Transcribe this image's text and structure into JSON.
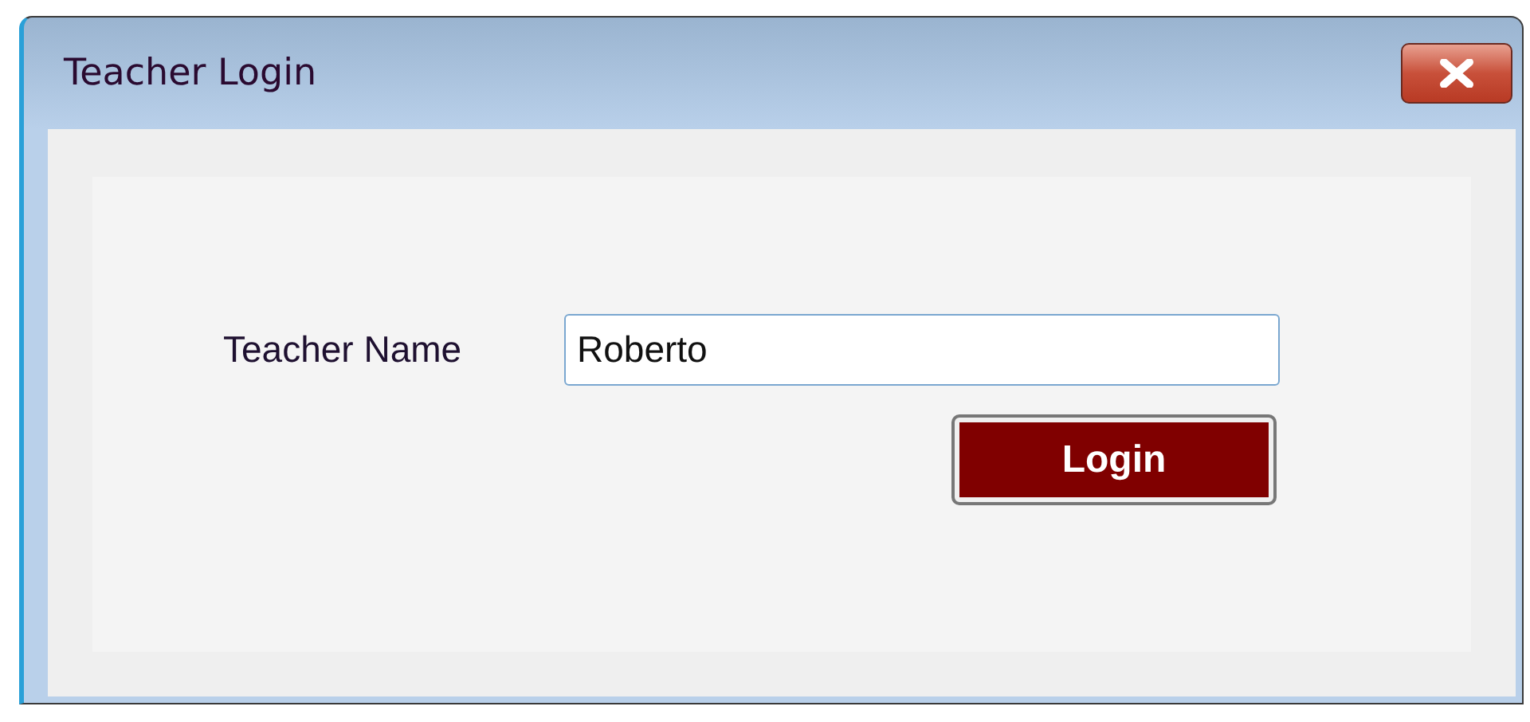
{
  "window": {
    "title": "Teacher Login"
  },
  "form": {
    "label": "Teacher Name",
    "value": "Roberto",
    "button": "Login"
  }
}
